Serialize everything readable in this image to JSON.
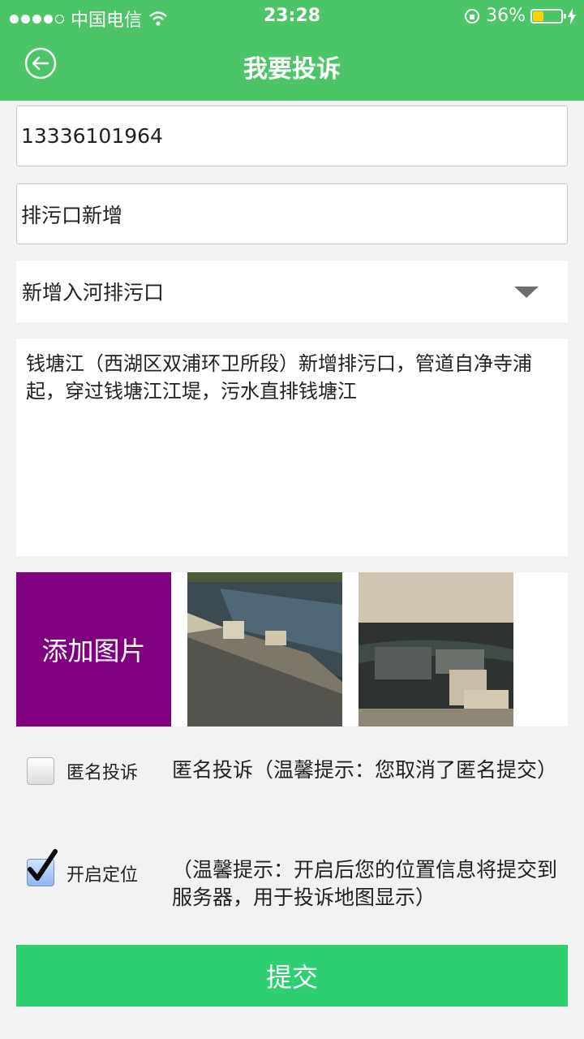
{
  "status": {
    "carrier": "中国电信",
    "time": "23:28",
    "battery": "36%",
    "battery_level": 0.36
  },
  "header": {
    "title": "我要投诉",
    "back_icon": "back-arrow-circle-icon"
  },
  "form": {
    "phone": "13336101964",
    "title": "排污口新增",
    "category": "新增入河排污口",
    "description": "钱塘江（西湖区双浦环卫所段）新增排污口，管道自净寺浦起，穿过钱塘江江堤，污水直排钱塘江"
  },
  "photos": {
    "add_label": "添加图片"
  },
  "anonymous": {
    "label": "匿名投诉",
    "checked": false,
    "hint": "匿名投诉（温馨提示：您取消了匿名提交）"
  },
  "location": {
    "label": "开启定位",
    "checked": true,
    "hint": "（温馨提示：开启后您的位置信息将提交到服务器，用于投诉地图显示）"
  },
  "submit_label": "提交",
  "colors": {
    "primary": "#4cc566",
    "submit": "#2ecf70",
    "add_photo": "#800080"
  }
}
